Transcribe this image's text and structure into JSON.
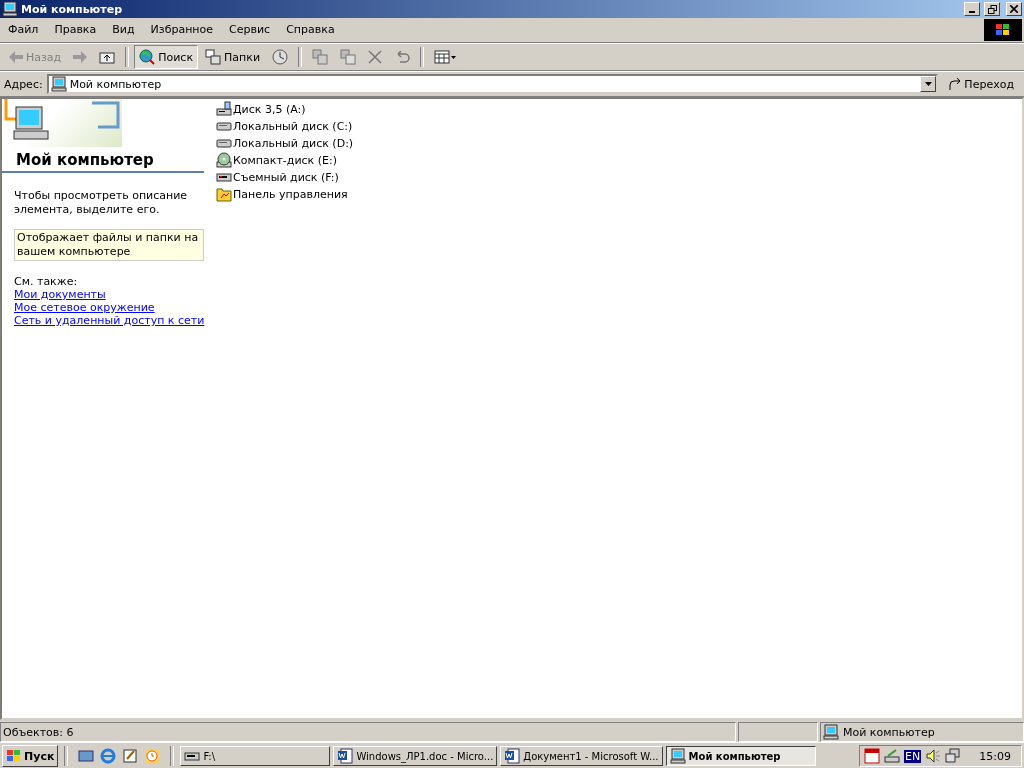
{
  "window": {
    "title": "Мой компьютер"
  },
  "menu": [
    "Файл",
    "Правка",
    "Вид",
    "Избранное",
    "Сервис",
    "Справка"
  ],
  "toolbar": [
    {
      "kind": "back",
      "label": "Назад",
      "disabled": true
    },
    {
      "kind": "forward",
      "disabled": true
    },
    {
      "kind": "up"
    },
    {
      "kind": "search",
      "label": "Поиск",
      "selected": true
    },
    {
      "kind": "folders",
      "label": "Папки",
      "selected": false
    },
    {
      "kind": "history"
    },
    {
      "kind": "move"
    },
    {
      "kind": "copy"
    },
    {
      "kind": "delete"
    },
    {
      "kind": "undo"
    },
    {
      "kind": "views"
    }
  ],
  "address": {
    "label": "Адрес:",
    "value": "Мой компьютер",
    "go": "Переход"
  },
  "panel": {
    "title": "Мой компьютер",
    "hint": "Чтобы просмотреть описание элемента, выделите его.",
    "description": "Отображает файлы и папки на вашем компьютере",
    "see_also": "См. также:",
    "links": [
      "Мои документы",
      "Мое сетевое окружение",
      "Сеть и удаленный доступ к сети"
    ]
  },
  "items": [
    {
      "kind": "floppy",
      "label": "Диск 3,5 (A:)"
    },
    {
      "kind": "hdd",
      "label": "Локальный диск (C:)"
    },
    {
      "kind": "hdd",
      "label": "Локальный диск (D:)"
    },
    {
      "kind": "cd",
      "label": "Компакт-диск (E:)"
    },
    {
      "kind": "removable",
      "label": "Съемный диск (F:)"
    },
    {
      "kind": "control",
      "label": "Панель управления"
    }
  ],
  "status_bar": {
    "count": "Объектов: 6",
    "zone": "Мой компьютер"
  },
  "taskbar": {
    "start": "Пуск",
    "tasks": [
      {
        "kind": "drive",
        "label": "F:\\",
        "selected": false
      },
      {
        "kind": "word",
        "label": "Windows_ЛР1.doc - Micro...",
        "selected": false
      },
      {
        "kind": "word",
        "label": "Документ1 - Microsoft W...",
        "selected": false
      },
      {
        "kind": "computer",
        "label": "Мой компьютер",
        "selected": true
      }
    ],
    "language": "EN",
    "clock": "15:09"
  }
}
